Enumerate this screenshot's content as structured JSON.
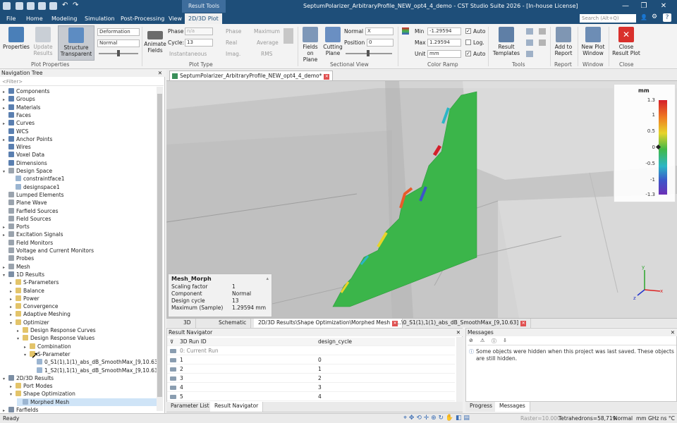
{
  "app": {
    "title": "SeptumPolarizer_ArbitraryProfile_NEW_opt4_4_demo - CST Studio Suite 2026 - [In-house License]",
    "context_tab": "Result Tools",
    "search_placeholder": "Search (Alt+Q)"
  },
  "menu_tabs": [
    "File",
    "Home",
    "Modeling",
    "Simulation",
    "Post-Processing",
    "View",
    "2D/3D Plot"
  ],
  "ribbon": {
    "properties": "Properties",
    "update_results": "Update Results",
    "structure_transparent": "Structure Transparent",
    "deformation": "Deformation",
    "normal": "Normal",
    "animate_fields": "Animate Fields",
    "phase_label": "Phase",
    "phase_value": "n/a",
    "cycle_label": "Cycle:",
    "cycle_value": "13",
    "instantaneous": "Instantaneous",
    "phase_chk": "Phase",
    "real_chk": "Real",
    "imag_chk": "Imag.",
    "maximum_chk": "Maximum",
    "average_chk": "Average",
    "rms_chk": "RMS",
    "fields_on_plane": "Fields on Plane",
    "cutting_plane": "Cutting Plane",
    "normal_label": "Normal",
    "normal_value": "X",
    "position_label": "Position",
    "position_value": "0",
    "min_label": "Min",
    "min_value": "-1.29594",
    "max_label": "Max",
    "max_value": "1.29594",
    "unit_label": "Unit",
    "unit_value": "mm",
    "auto1": "Auto",
    "log": "Log.",
    "auto2": "Auto",
    "result_templates": "Result Templates",
    "add_to_report": "Add to Report",
    "new_plot_window": "New Plot Window",
    "close_result_plot": "Close Result Plot",
    "groups": [
      "Plot Properties",
      "Plot Type",
      "Sectional View",
      "Color Ramp",
      "Tools",
      "Report",
      "Window",
      "Close"
    ]
  },
  "nav": {
    "title": "Navigation Tree",
    "filter_placeholder": "<Filter>",
    "items": [
      {
        "label": "Components",
        "indent": 0,
        "icon": "blue",
        "exp": "▸"
      },
      {
        "label": "Groups",
        "indent": 0,
        "icon": "blue",
        "exp": "▸"
      },
      {
        "label": "Materials",
        "indent": 0,
        "icon": "blue",
        "exp": "▸"
      },
      {
        "label": "Faces",
        "indent": 0,
        "icon": "blue",
        "exp": ""
      },
      {
        "label": "Curves",
        "indent": 0,
        "icon": "blue",
        "exp": "▸"
      },
      {
        "label": "WCS",
        "indent": 0,
        "icon": "blue",
        "exp": ""
      },
      {
        "label": "Anchor Points",
        "indent": 0,
        "icon": "blue",
        "exp": "▸"
      },
      {
        "label": "Wires",
        "indent": 0,
        "icon": "blue",
        "exp": ""
      },
      {
        "label": "Voxel Data",
        "indent": 0,
        "icon": "blue",
        "exp": ""
      },
      {
        "label": "Dimensions",
        "indent": 0,
        "icon": "blue",
        "exp": ""
      },
      {
        "label": "Design Space",
        "indent": 0,
        "icon": "gear",
        "exp": "▾"
      },
      {
        "label": "constraintface1",
        "indent": 1,
        "icon": "file",
        "exp": ""
      },
      {
        "label": "designspace1",
        "indent": 1,
        "icon": "file",
        "exp": ""
      },
      {
        "label": "Lumped Elements",
        "indent": 0,
        "icon": "gear",
        "exp": ""
      },
      {
        "label": "Plane Wave",
        "indent": 0,
        "icon": "gear",
        "exp": ""
      },
      {
        "label": "Farfield Sources",
        "indent": 0,
        "icon": "gear",
        "exp": ""
      },
      {
        "label": "Field Sources",
        "indent": 0,
        "icon": "gear",
        "exp": ""
      },
      {
        "label": "Ports",
        "indent": 0,
        "icon": "gear",
        "exp": "▸"
      },
      {
        "label": "Excitation Signals",
        "indent": 0,
        "icon": "gear",
        "exp": "▸"
      },
      {
        "label": "Field Monitors",
        "indent": 0,
        "icon": "gear",
        "exp": ""
      },
      {
        "label": "Voltage and Current Monitors",
        "indent": 0,
        "icon": "gear",
        "exp": ""
      },
      {
        "label": "Probes",
        "indent": 0,
        "icon": "gear",
        "exp": ""
      },
      {
        "label": "Mesh",
        "indent": 0,
        "icon": "gear",
        "exp": "▸"
      },
      {
        "label": "1D Results",
        "indent": 0,
        "icon": "res",
        "exp": "▾"
      },
      {
        "label": "S-Parameters",
        "indent": 1,
        "icon": "fold",
        "exp": "▸"
      },
      {
        "label": "Balance",
        "indent": 1,
        "icon": "fold",
        "exp": "▸"
      },
      {
        "label": "Power",
        "indent": 1,
        "icon": "fold",
        "exp": "▸"
      },
      {
        "label": "Convergence",
        "indent": 1,
        "icon": "fold",
        "exp": "▸"
      },
      {
        "label": "Adaptive Meshing",
        "indent": 1,
        "icon": "fold",
        "exp": "▸"
      },
      {
        "label": "Optimizer",
        "indent": 1,
        "icon": "fold",
        "exp": "▾"
      },
      {
        "label": "Design Response Curves",
        "indent": 2,
        "icon": "fold",
        "exp": "▸"
      },
      {
        "label": "Design Response Values",
        "indent": 2,
        "icon": "fold",
        "exp": "▾"
      },
      {
        "label": "Combination",
        "indent": 3,
        "icon": "fold",
        "exp": "▸"
      },
      {
        "label": "S-Parameter",
        "indent": 3,
        "icon": "fold",
        "exp": "▾",
        "hover": true
      },
      {
        "label": "0_S1(1),1(1)_abs_dB_SmoothMax_[9,10.63]",
        "indent": 4,
        "icon": "file",
        "exp": ""
      },
      {
        "label": "1_S2(1),1(1)_abs_dB_SmoothMax_[9,10.63]",
        "indent": 4,
        "icon": "file",
        "exp": ""
      },
      {
        "label": "2D/3D Results",
        "indent": 0,
        "icon": "res",
        "exp": "▾"
      },
      {
        "label": "Port Modes",
        "indent": 1,
        "icon": "fold",
        "exp": "▸"
      },
      {
        "label": "Shape Optimization",
        "indent": 1,
        "icon": "fold",
        "exp": "▾"
      },
      {
        "label": "Morphed Mesh",
        "indent": 2,
        "icon": "file",
        "exp": "",
        "selected": true
      },
      {
        "label": "Farfields",
        "indent": 0,
        "icon": "res",
        "exp": "▸"
      }
    ]
  },
  "document_tab": "SeptumPolarizer_ArbitraryProfile_NEW_opt4_4_demo*",
  "info_box": {
    "title": "Mesh_Morph",
    "rows": [
      {
        "k": "Scaling factor",
        "v": "1"
      },
      {
        "k": "Component",
        "v": "Normal"
      },
      {
        "k": "Design cycle",
        "v": "13"
      },
      {
        "k": "Maximum (Sample)",
        "v": "1.29594 mm"
      }
    ]
  },
  "colorbar": {
    "unit": "mm",
    "ticks": [
      "1.3",
      "1",
      "0.5",
      "0",
      "-0.5",
      "-1",
      "-1.3"
    ]
  },
  "view_tabs": [
    "3D",
    "Schematic",
    "2D/3D Results\\Shape Optimization\\Morphed Mesh",
    "...\\0_S1(1),1(1)_abs_dB_SmoothMax_[9,10.63]"
  ],
  "result_navigator": {
    "title": "Result Navigator",
    "col_run": "3D Run ID",
    "col_cycle": "design_cycle",
    "rows": [
      {
        "id": "0: Current Run",
        "cycle": ""
      },
      {
        "id": "1",
        "cycle": "0"
      },
      {
        "id": "2",
        "cycle": "1"
      },
      {
        "id": "3",
        "cycle": "2"
      },
      {
        "id": "4",
        "cycle": "3"
      },
      {
        "id": "5",
        "cycle": "4"
      }
    ],
    "tabs": [
      "Parameter List",
      "Result Navigator"
    ]
  },
  "messages": {
    "title": "Messages",
    "text": "Some objects were hidden when this project was last saved. These objects are still hidden.",
    "tabs": [
      "Progress",
      "Messages"
    ]
  },
  "status": {
    "ready": "Ready",
    "raster": "Raster=10.000",
    "tetra": "Tetrahedrons=58,719",
    "mode": "Normal",
    "units": "mm  GHz  ns  °C"
  },
  "colors": {
    "titlebar": "#1e4e79",
    "morph_surface": "#3bb54a",
    "accent": "#1e4e79"
  }
}
